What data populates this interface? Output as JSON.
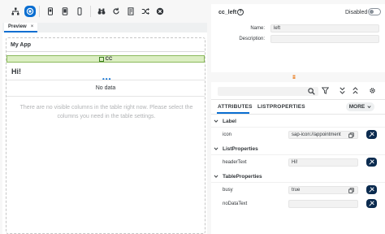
{
  "toolbar": {
    "buttons": [
      {
        "icon": "hierarchy-icon"
      },
      {
        "icon": "eye-icon",
        "active": true
      },
      {
        "icon": "phone-icon"
      },
      {
        "icon": "tablet-icon"
      },
      {
        "icon": "mobile-icon"
      },
      {
        "icon": "binoculars-icon"
      },
      {
        "icon": "refresh-icon"
      },
      {
        "icon": "document-icon"
      },
      {
        "icon": "shuffle-icon"
      },
      {
        "icon": "close-icon"
      }
    ]
  },
  "preview_tab": {
    "label": "Preview",
    "close": "×"
  },
  "preview": {
    "app_title": "My App",
    "cc_label": "CC",
    "heading": "Hi!",
    "busy_dots": "•••",
    "no_data": "No data",
    "no_columns": "There are no visible columns in the table right now. Please select the columns you need in the table settings."
  },
  "control": {
    "name": "cc_left",
    "help": "?",
    "disabled_label": "Disabled",
    "fields": [
      {
        "label": "Name:",
        "value": "left"
      },
      {
        "label": "Description:",
        "value": ""
      }
    ]
  },
  "properties": {
    "tabs": [
      "ATTRIBUTES",
      "LISTPROPERTIES"
    ],
    "more": "MORE",
    "groups": [
      {
        "title": "Label",
        "rows": [
          {
            "label": "icon",
            "value": "sap-icon://appointment"
          }
        ]
      },
      {
        "title": "ListProperties",
        "rows": [
          {
            "label": "headerText",
            "value": "Hi!"
          }
        ]
      },
      {
        "title": "TableProperties",
        "rows": [
          {
            "label": "busy",
            "value": "true"
          },
          {
            "label": "noDataText",
            "value": ""
          }
        ]
      }
    ]
  },
  "colors": {
    "accent": "#0a6ed1",
    "bind_button": "#0b2b4f",
    "cc_bar": "#dbeec2"
  }
}
